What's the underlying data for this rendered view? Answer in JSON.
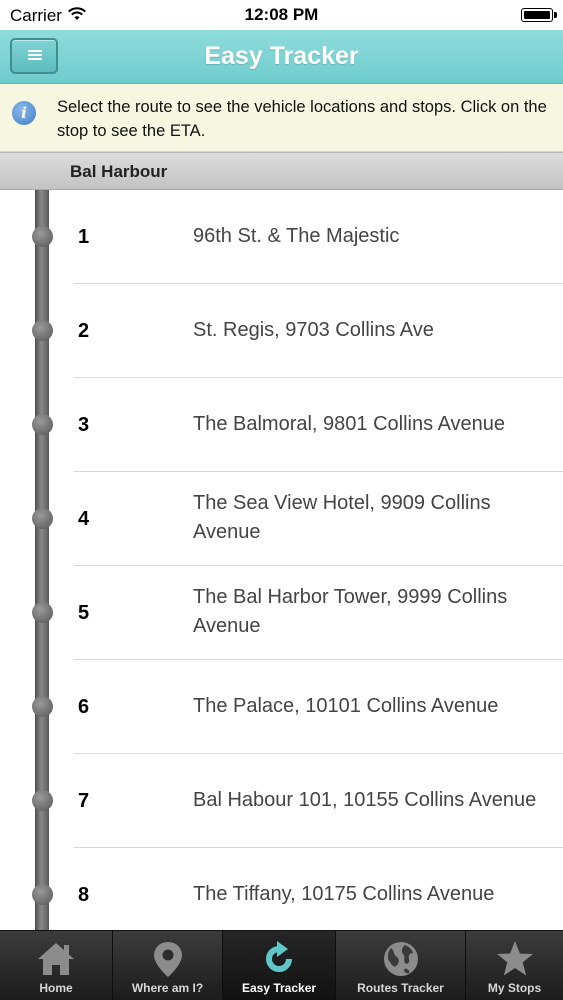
{
  "status_bar": {
    "carrier": "Carrier",
    "time": "12:08 PM"
  },
  "nav": {
    "title": "Easy Tracker",
    "menu_icon": "menu-icon"
  },
  "info": {
    "text": "Select the route to see the vehicle locations and stops. Click on the stop to see the ETA.",
    "icon": "info-icon"
  },
  "route": {
    "name": "Bal Harbour"
  },
  "stops": [
    {
      "number": "1",
      "name": "96th St. & The Majestic"
    },
    {
      "number": "2",
      "name": "St. Regis, 9703 Collins Ave"
    },
    {
      "number": "3",
      "name": "The Balmoral, 9801 Collins Avenue"
    },
    {
      "number": "4",
      "name": "The Sea View Hotel, 9909 Collins Avenue"
    },
    {
      "number": "5",
      "name": "The Bal Harbor Tower, 9999 Collins Avenue"
    },
    {
      "number": "6",
      "name": "The Palace, 10101 Collins Avenue"
    },
    {
      "number": "7",
      "name": "Bal Habour 101, 10155 Collins Avenue"
    },
    {
      "number": "8",
      "name": "The Tiffany, 10175 Collins Avenue"
    }
  ],
  "tabs": [
    {
      "label": "Home",
      "icon": "home-icon",
      "active": false
    },
    {
      "label": "Where am I?",
      "icon": "location-pin-icon",
      "active": false
    },
    {
      "label": "Easy Tracker",
      "icon": "refresh-icon",
      "active": true
    },
    {
      "label": "Routes Tracker",
      "icon": "globe-icon",
      "active": false
    },
    {
      "label": "My Stops",
      "icon": "star-icon",
      "active": false
    }
  ],
  "colors": {
    "nav_bar": "#79d2d3",
    "info_background": "#f7f6e0",
    "active_tab_icon": "#5fc7c9"
  }
}
